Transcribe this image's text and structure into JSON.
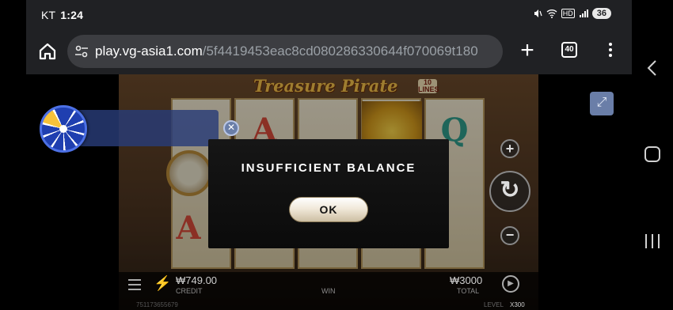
{
  "status_bar": {
    "carrier": "KT",
    "time": "1:24",
    "signal_badge": "HD",
    "battery": "36"
  },
  "browser": {
    "url_host": "play.vg-asia1.com",
    "url_path": "/5f4419453eac8cd080286330644f070069t180",
    "tab_count": "40"
  },
  "game": {
    "title": "Treasure Pirate",
    "lines_badge": "10 LINES",
    "credit_value": "₩749.00",
    "credit_label": "CREDIT",
    "win_label": "WIN",
    "total_value": "₩3000",
    "total_label": "TOTAL",
    "round_id": "751173655679",
    "level_label": "LEVEL",
    "level_value": "X300",
    "symbols": [
      "A",
      "Q",
      "A"
    ]
  },
  "modal": {
    "title": "INSUFFICIENT BALANCE",
    "ok_label": "OK"
  },
  "icons": {
    "home": "home-icon",
    "site_settings": "tune-icon",
    "new_tab": "plus-icon",
    "menu": "more-vert-icon",
    "fullscreen": "fullscreen-icon",
    "spin": "spin-icon",
    "close": "close-icon"
  },
  "colors": {
    "browser_bg": "#202124",
    "urlbox_bg": "#3c3d41",
    "modal_bg": "#111111",
    "ok_button": "#f1e9da",
    "gold_title": "#f2c04a"
  }
}
